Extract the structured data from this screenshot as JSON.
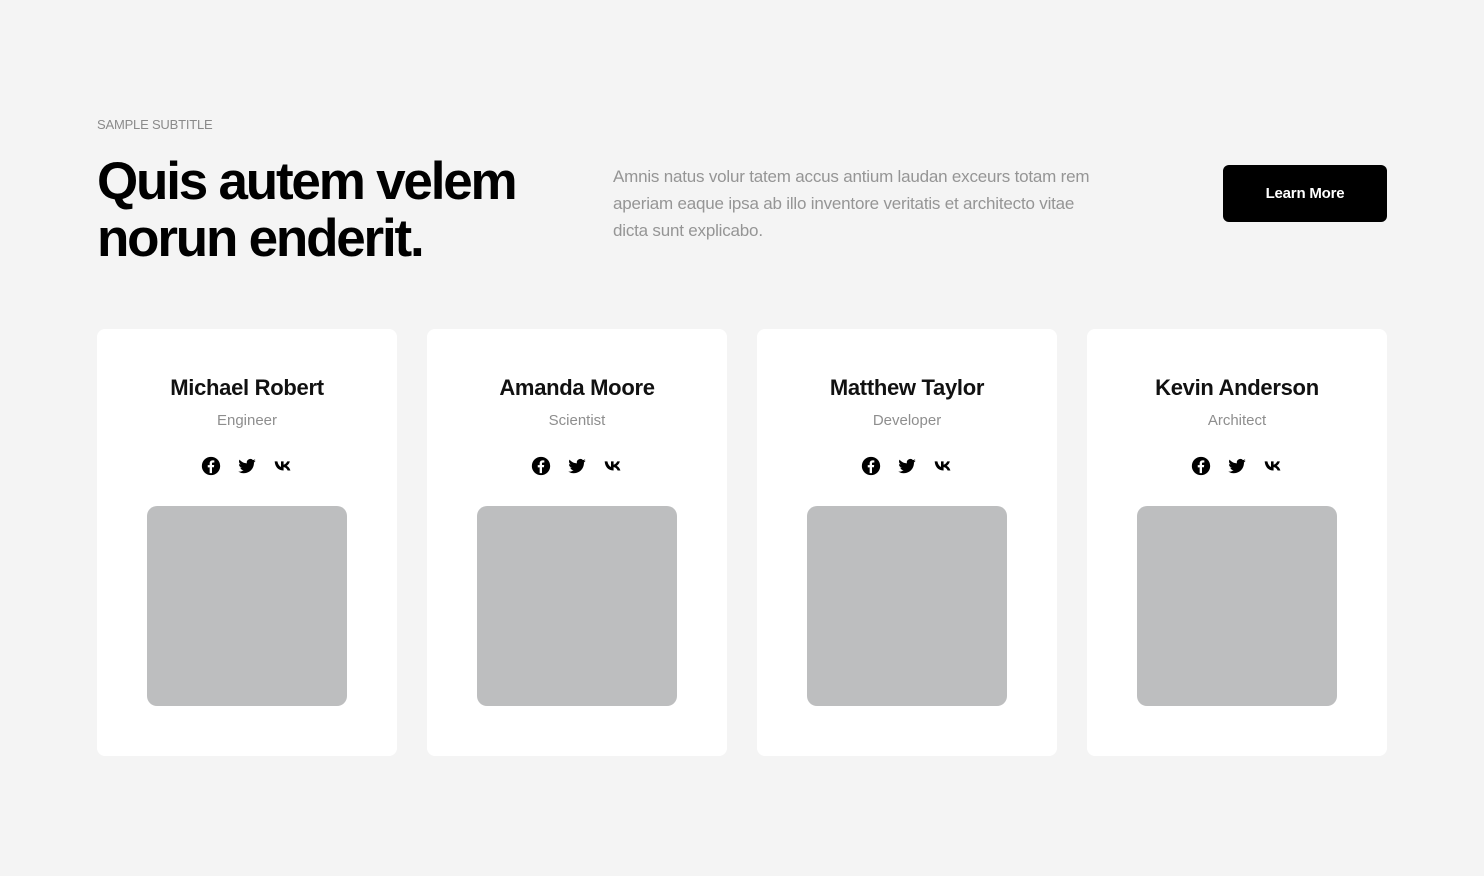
{
  "header": {
    "subtitle": "SAMPLE SUBTITLE",
    "title": "Quis autem velem norun enderit.",
    "description": "Amnis natus volur tatem accus antium laudan exceurs totam rem aperiam eaque ipsa ab illo inventore veritatis et architecto vitae dicta sunt explicabo.",
    "cta_label": "Learn More"
  },
  "team": [
    {
      "name": "Michael Robert",
      "role": "Engineer"
    },
    {
      "name": "Amanda Moore",
      "role": "Scientist"
    },
    {
      "name": "Matthew Taylor",
      "role": "Developer"
    },
    {
      "name": "Kevin Anderson",
      "role": "Architect"
    }
  ],
  "social_icons": [
    "facebook-icon",
    "twitter-icon",
    "vk-icon"
  ],
  "colors": {
    "background": "#f4f4f4",
    "card": "#ffffff",
    "button": "#000000",
    "photo_placeholder": "#bdbebf",
    "muted_text": "#959595"
  }
}
